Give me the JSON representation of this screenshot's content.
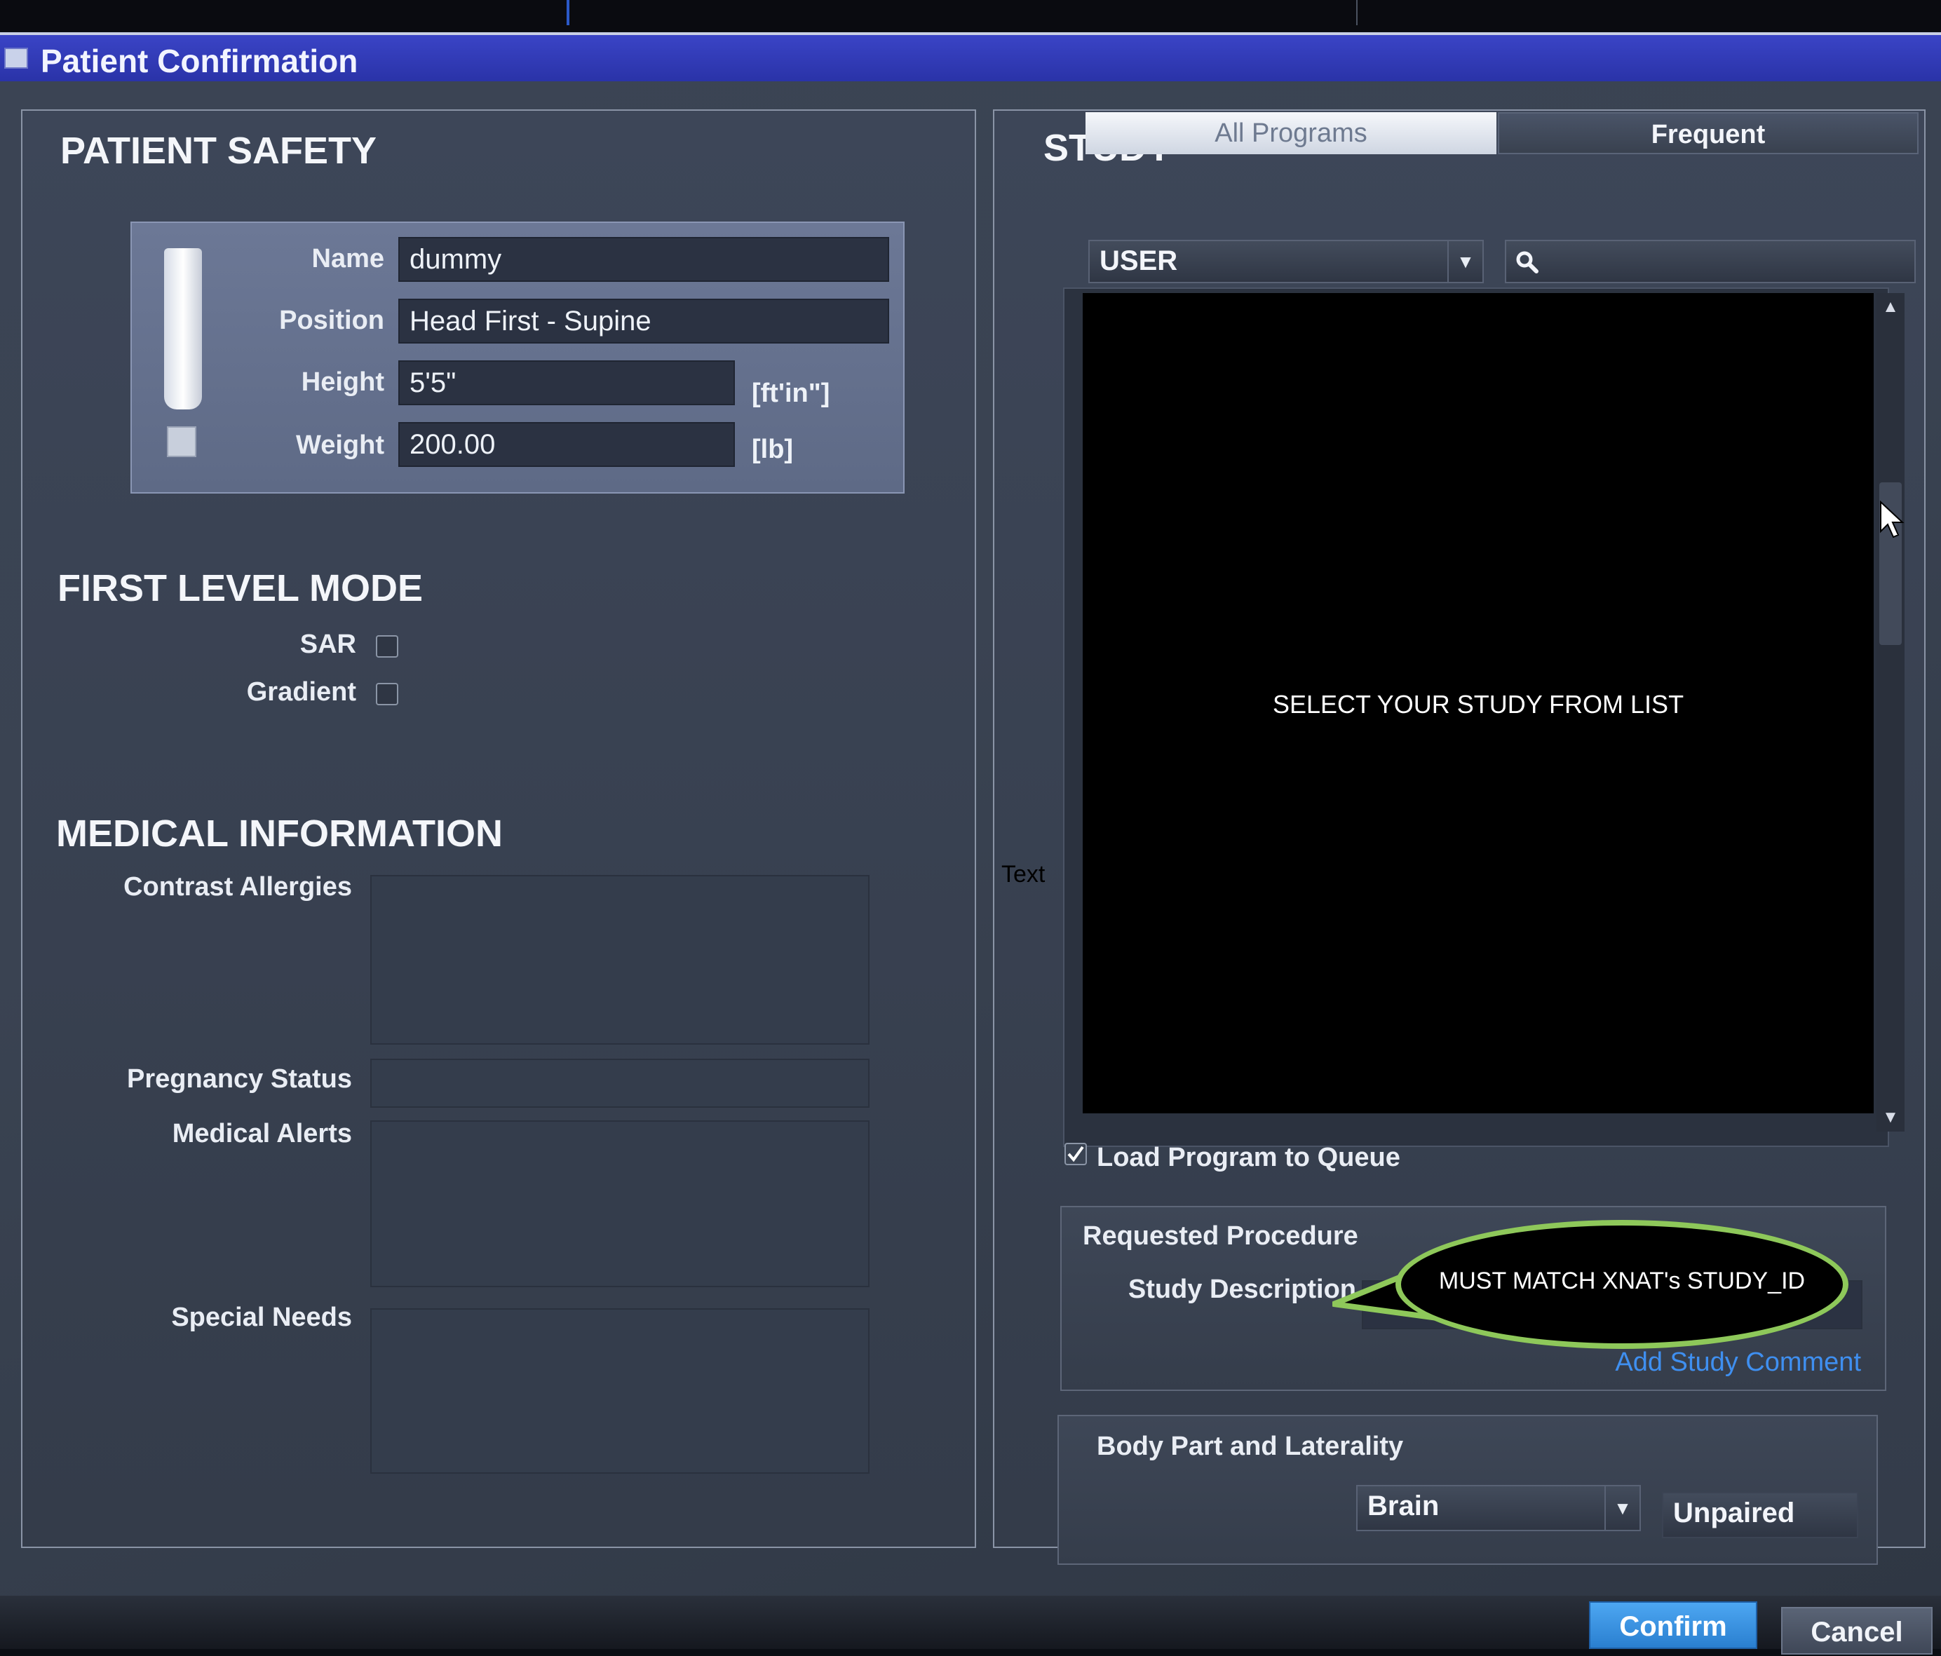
{
  "window": {
    "title": "Patient Confirmation"
  },
  "patient_safety": {
    "heading": "PATIENT SAFETY",
    "name_label": "Name",
    "name_value": "dummy",
    "position_label": "Position",
    "position_value": "Head First - Supine",
    "height_label": "Height",
    "height_value": "5'5\"",
    "height_unit": "[ft'in\"]",
    "weight_label": "Weight",
    "weight_value": "200.00",
    "weight_unit": "[lb]"
  },
  "first_level_mode": {
    "heading": "FIRST LEVEL MODE",
    "sar_label": "SAR",
    "sar_checked": false,
    "gradient_label": "Gradient",
    "gradient_checked": false
  },
  "medical_information": {
    "heading": "MEDICAL INFORMATION",
    "contrast_allergies_label": "Contrast Allergies",
    "pregnancy_status_label": "Pregnancy Status",
    "medical_alerts_label": "Medical Alerts",
    "special_needs_label": "Special Needs"
  },
  "study": {
    "heading": "STUDY",
    "tabs": [
      {
        "label": "All Programs",
        "active": true
      },
      {
        "label": "Frequent",
        "active": false
      }
    ],
    "category_value": "USER",
    "list_message": "SELECT YOUR STUDY FROM LIST",
    "load_to_queue_label": "Load Program to Queue",
    "load_to_queue_checked": true,
    "requested_procedure_heading": "Requested Procedure",
    "study_description_label": "Study Description",
    "add_comment_link": "Add Study Comment",
    "body_part_heading": "Body Part and Laterality",
    "body_part_value": "Brain",
    "laterality_value": "Unpaired"
  },
  "annotation": {
    "callout_text": "MUST MATCH XNAT's STUDY_ID",
    "stray_text": "Text"
  },
  "actions": {
    "confirm_label": "Confirm",
    "cancel_label": "Cancel"
  },
  "colors": {
    "titlebar": "#2f39b4",
    "confirm": "#3a93e2",
    "callout_border": "#8ec85a",
    "link": "#3f8ff0"
  },
  "icons": [
    "window-icon",
    "search-icon",
    "chevron-down-icon",
    "scroll-up-icon",
    "scroll-down-icon",
    "checkbox-checked-icon",
    "warning-exclamation-icon",
    "mouse-cursor-icon"
  ]
}
